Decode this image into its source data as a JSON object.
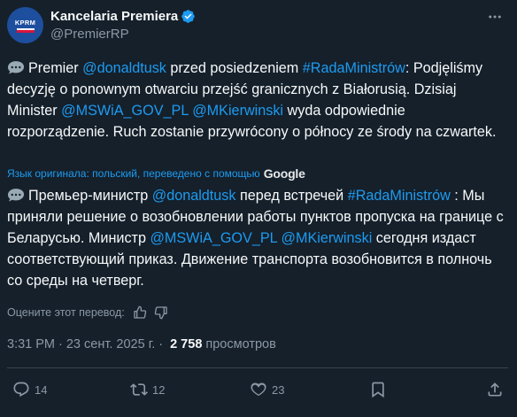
{
  "author": {
    "name": "Kancelaria Premiera",
    "handle": "@PremierRP",
    "avatar_text": "KPRM"
  },
  "original": {
    "segments": [
      {
        "t": "Premier ",
        "link": false
      },
      {
        "t": "@donaldtusk",
        "link": true
      },
      {
        "t": " przed posiedzeniem ",
        "link": false
      },
      {
        "t": "#RadaMinistrów",
        "link": true
      },
      {
        "t": ": Podjęliśmy decyzję o ponownym otwarciu przejść granicznych z Białorusią. Dzisiaj Minister ",
        "link": false
      },
      {
        "t": "@MSWiA_GOV_PL",
        "link": true
      },
      {
        "t": " ",
        "link": false
      },
      {
        "t": "@MKierwinski",
        "link": true
      },
      {
        "t": " wyda odpowiednie rozporządzenie. Ruch zostanie przywrócony o północy ze środy na czwartek.",
        "link": false
      }
    ]
  },
  "translation_note": {
    "text": "Язык оригинала: польский, переведено с помощью",
    "provider": "Google"
  },
  "translated": {
    "segments": [
      {
        "t": "Премьер-министр ",
        "link": false
      },
      {
        "t": "@donaldtusk",
        "link": true
      },
      {
        "t": " перед встречей ",
        "link": false
      },
      {
        "t": "#RadaMinistrów",
        "link": true
      },
      {
        "t": " : Мы приняли решение о возобновлении работы пунктов пропуска на границе с Беларусью. Министр ",
        "link": false
      },
      {
        "t": "@MSWiA_GOV_PL",
        "link": true
      },
      {
        "t": " ",
        "link": false
      },
      {
        "t": "@MKierwinski",
        "link": true
      },
      {
        "t": " сегодня издаст соответствующий приказ. Движение транспорта возобновится в полночь со среды на четверг.",
        "link": false
      }
    ]
  },
  "rate": {
    "label": "Оцените этот перевод:"
  },
  "meta": {
    "time": "3:31 PM",
    "date": "23 сент. 2025 г.",
    "views_count": "2 758",
    "views_label": "просмотров",
    "separator": "·"
  },
  "actions": {
    "replies": "14",
    "reposts": "12",
    "likes": "23"
  },
  "colors": {
    "background": "#15202b",
    "text": "#f7f9f9",
    "secondary": "#8b98a5",
    "link": "#1d9bf0",
    "divider": "#38444d"
  }
}
